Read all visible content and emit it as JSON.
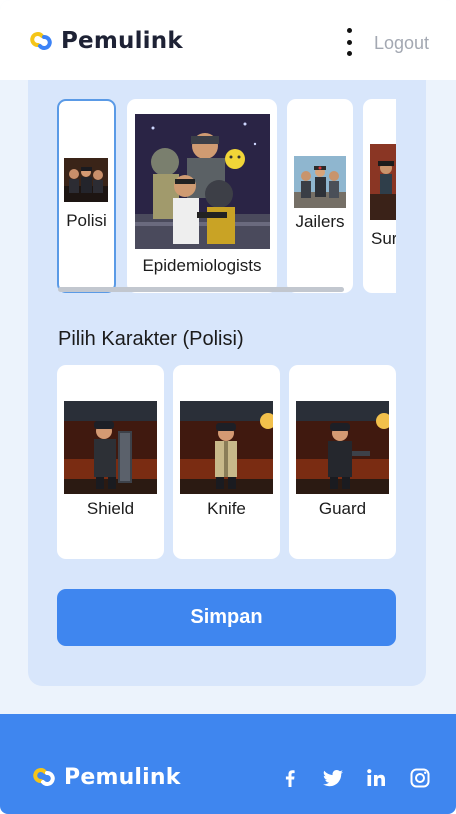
{
  "header": {
    "brand_name": "Pemulink",
    "menu_icon": "more-vertical-icon",
    "logout_label": "Logout"
  },
  "categories": [
    {
      "label": "Polisi",
      "selected": true
    },
    {
      "label": "Epidemiologists",
      "selected": false
    },
    {
      "label": "Jailers",
      "selected": false
    },
    {
      "label": "Sur",
      "selected": false
    }
  ],
  "characters": {
    "section_title": "Pilih Karakter (Polisi)",
    "items": [
      {
        "label": "Shield"
      },
      {
        "label": "Knife"
      },
      {
        "label": "Guard"
      }
    ]
  },
  "actions": {
    "save_label": "Simpan"
  },
  "footer": {
    "brand_name": "Pemulink",
    "social_icons": [
      "facebook-icon",
      "twitter-icon",
      "linkedin-icon",
      "instagram-icon"
    ]
  },
  "colors": {
    "accent": "#3f86ef",
    "panel": "#d8e6fb",
    "selected_border": "#5a9ae6",
    "logo_blue": "#3b82f6",
    "logo_yellow": "#f5c518"
  }
}
